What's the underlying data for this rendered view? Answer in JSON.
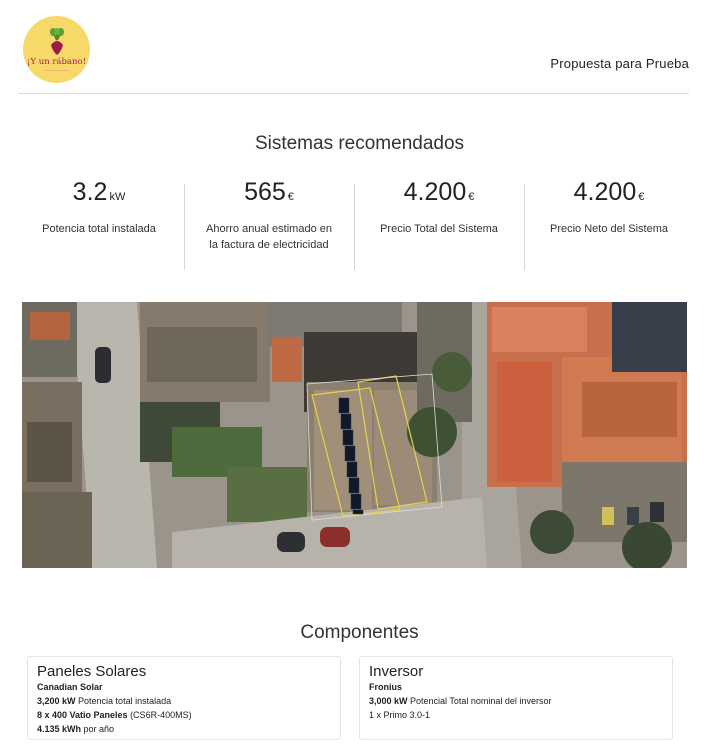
{
  "header": {
    "logo_text": "¡Y un rábano!",
    "proposal_title": "Propuesta para Prueba"
  },
  "recommended": {
    "title": "Sistemas recomendados",
    "stats": [
      {
        "value": "3.2",
        "unit": "kW",
        "description": "Potencia total instalada"
      },
      {
        "value": "565",
        "unit": "€",
        "description": "Ahorro anual estimado en la factura de electricidad"
      },
      {
        "value": "4.200",
        "unit": "€",
        "description": "Precio Total del Sistema"
      },
      {
        "value": "4.200",
        "unit": "€",
        "description": "Precio Neto del Sistema"
      }
    ]
  },
  "components": {
    "title": "Componentes",
    "panels": {
      "title": "Paneles Solares",
      "brand": "Canadian Solar",
      "power_bold": "3,200 kW",
      "power_text": " Potencia total instalada",
      "count_bold": "8 x 400 Vatio Paneles",
      "count_text": " (CS6R-400MS)",
      "production_bold": "4.135 kWh",
      "production_text": " por año"
    },
    "inverter": {
      "title": "Inversor",
      "brand": "Fronius",
      "power_bold": "3,000 kW",
      "power_text": " Potencial Total nominal del inversor",
      "model": "1 x Primo 3.0-1"
    }
  },
  "colors": {
    "logo_bg": "#f7d96a",
    "logo_text": "#a0224a",
    "roof_outline": "#e8d24a",
    "panel": "#111827"
  }
}
